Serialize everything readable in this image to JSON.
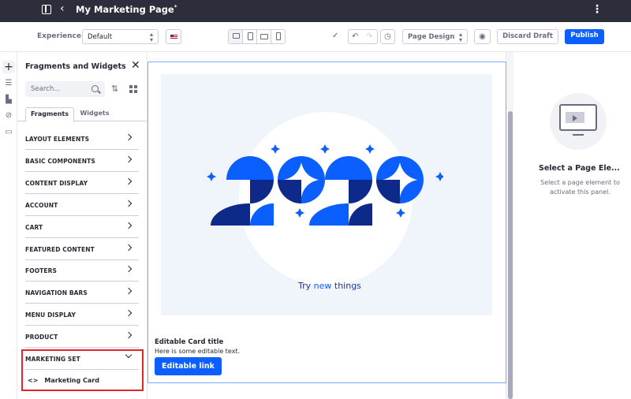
{
  "header": {
    "title": "My Marketing Page",
    "title_marker": "*"
  },
  "toolbar": {
    "experience_label": "Experience",
    "experience_value": "Default",
    "page_design_label": "Page Design",
    "discard_label": "Discard Draft",
    "publish_label": "Publish"
  },
  "panel": {
    "title": "Fragments and Widgets",
    "search_placeholder": "Search...",
    "tabs": [
      "Fragments",
      "Widgets"
    ],
    "categories": [
      "LAYOUT ELEMENTS",
      "BASIC COMPONENTS",
      "CONTENT DISPLAY",
      "ACCOUNT",
      "CART",
      "FEATURED CONTENT",
      "FOOTERS",
      "NAVIGATION BARS",
      "MENU DISPLAY",
      "PRODUCT",
      "MARKETING SET"
    ],
    "expanded_item": "Marketing Card",
    "expanded_item_icon": "<>"
  },
  "canvas": {
    "hero_text_prefix": "Try ",
    "hero_text_accent": "new",
    "hero_text_suffix": " things",
    "card_title": "Editable Card title",
    "card_text": "Here is some editable text.",
    "card_link": "Editable link"
  },
  "right_panel": {
    "title": "Select a Page Ele...",
    "description": "Select a page element to activate this panel."
  },
  "colors": {
    "primary": "#0b5fff",
    "topbar": "#2d2e3b",
    "highlight": "#e0262b",
    "hero_dark": "#0d2a8a"
  }
}
